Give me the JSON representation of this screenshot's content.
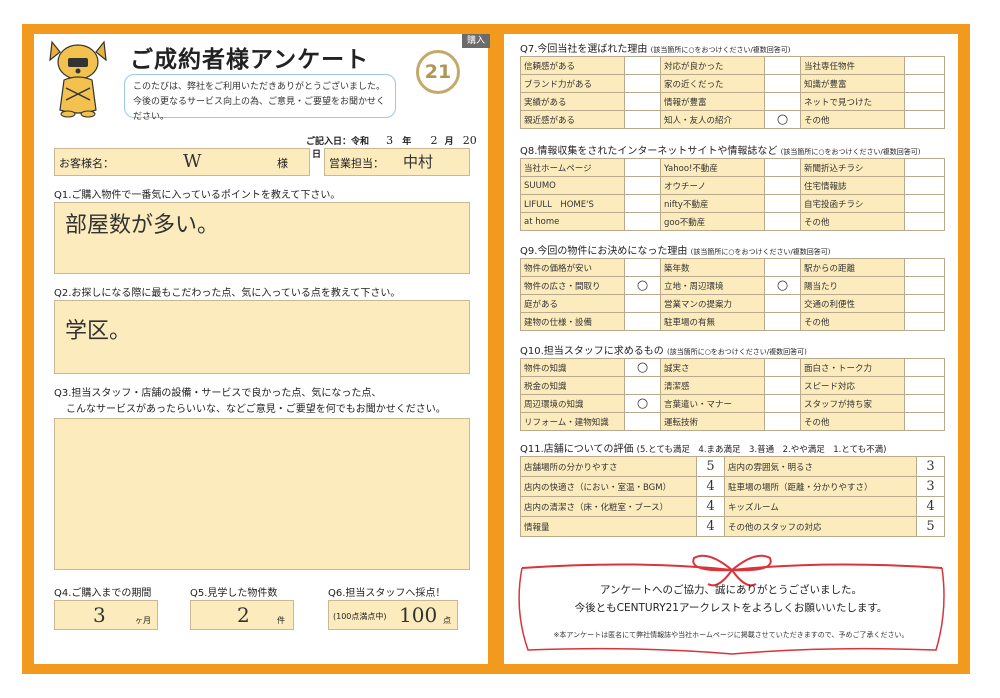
{
  "header": {
    "tag": "購入",
    "title": "ご成約者様アンケート",
    "intro_line1": "このたびは、弊社をご利用いただきありがとうございました。",
    "intro_line2": "今後の更なるサービス向上の為、ご意見・ご要望をお聞かせください。",
    "logo_text": "21",
    "date": {
      "label": "ご記入日：令和",
      "year": "3",
      "year_unit": "年",
      "month": "2",
      "month_unit": "月",
      "day": "20",
      "day_unit": "日"
    }
  },
  "customer": {
    "label": "お客様名：",
    "value": "W",
    "suffix": "様"
  },
  "staff": {
    "label": "営業担当：",
    "value": "中村"
  },
  "q1": {
    "question": "Q1.ご購入物件で一番気に入っているポイントを教えて下さい。",
    "answer": "部屋数が多い。"
  },
  "q2": {
    "question": "Q2.お探しになる際に最もこだわった点、気に入っている点を教えて下さい。",
    "answer": "学区。"
  },
  "q3": {
    "question_line1": "Q3.担当スタッフ・店舗の設備・サービスで良かった点、気になった点、",
    "question_line2": "こんなサービスがあったらいいな、などご意見・ご要望を何でもお聞かせください。",
    "answer": ""
  },
  "q4": {
    "question": "Q4.ご購入までの期間",
    "value": "3",
    "unit": "ヶ月"
  },
  "q5": {
    "question": "Q5.見学した物件数",
    "value": "2",
    "unit": "件"
  },
  "q6": {
    "question": "Q6.担当スタッフへ採点！",
    "prefix": "(100点満点中)",
    "value": "100",
    "unit": "点"
  },
  "q7": {
    "question": "Q7.今回当社を選ばれた理由",
    "note": "(該当箇所に○をおつけください/複数回答可)",
    "rows": [
      [
        {
          "label": "信頼感がある",
          "mark": ""
        },
        {
          "label": "対応が良かった",
          "mark": ""
        },
        {
          "label": "当社専任物件",
          "mark": ""
        }
      ],
      [
        {
          "label": "ブランド力がある",
          "mark": ""
        },
        {
          "label": "家の近くだった",
          "mark": ""
        },
        {
          "label": "知識が豊富",
          "mark": ""
        }
      ],
      [
        {
          "label": "実績がある",
          "mark": ""
        },
        {
          "label": "情報が豊富",
          "mark": ""
        },
        {
          "label": "ネットで見つけた",
          "mark": ""
        }
      ],
      [
        {
          "label": "親近感がある",
          "mark": ""
        },
        {
          "label": "知人・友人の紹介",
          "mark": "○"
        },
        {
          "label": "その他",
          "mark": ""
        }
      ]
    ]
  },
  "q8": {
    "question": "Q8.情報収集をされたインターネットサイトや情報誌など",
    "note": "(該当箇所に○をおつけください/複数回答可)",
    "rows": [
      [
        {
          "label": "当社ホームページ",
          "mark": ""
        },
        {
          "label": "Yahoo!不動産",
          "mark": ""
        },
        {
          "label": "新聞折込チラシ",
          "mark": ""
        }
      ],
      [
        {
          "label": "SUUMO",
          "mark": ""
        },
        {
          "label": "オウチーノ",
          "mark": ""
        },
        {
          "label": "住宅情報誌",
          "mark": ""
        }
      ],
      [
        {
          "label": "LIFULL　HOME'S",
          "mark": ""
        },
        {
          "label": "nifty不動産",
          "mark": ""
        },
        {
          "label": "自宅投函チラシ",
          "mark": ""
        }
      ],
      [
        {
          "label": "at home",
          "mark": ""
        },
        {
          "label": "goo不動産",
          "mark": ""
        },
        {
          "label": "その他",
          "mark": ""
        }
      ]
    ]
  },
  "q9": {
    "question": "Q9.今回の物件にお決めになった理由",
    "note": "(該当箇所に○をおつけください/複数回答可)",
    "rows": [
      [
        {
          "label": "物件の価格が安い",
          "mark": ""
        },
        {
          "label": "築年数",
          "mark": ""
        },
        {
          "label": "駅からの距離",
          "mark": ""
        }
      ],
      [
        {
          "label": "物件の広さ・間取り",
          "mark": "○"
        },
        {
          "label": "立地・周辺環境",
          "mark": "○"
        },
        {
          "label": "陽当たり",
          "mark": ""
        }
      ],
      [
        {
          "label": "庭がある",
          "mark": ""
        },
        {
          "label": "営業マンの提案力",
          "mark": ""
        },
        {
          "label": "交通の利便性",
          "mark": ""
        }
      ],
      [
        {
          "label": "建物の仕様・設備",
          "mark": ""
        },
        {
          "label": "駐車場の有無",
          "mark": ""
        },
        {
          "label": "その他",
          "mark": ""
        }
      ]
    ]
  },
  "q10": {
    "question": "Q10.担当スタッフに求めるもの",
    "note": "(該当箇所に○をおつけください/複数回答可)",
    "rows": [
      [
        {
          "label": "物件の知識",
          "mark": "○"
        },
        {
          "label": "誠実さ",
          "mark": ""
        },
        {
          "label": "面白さ・トーク力",
          "mark": ""
        }
      ],
      [
        {
          "label": "税金の知識",
          "mark": ""
        },
        {
          "label": "清潔感",
          "mark": ""
        },
        {
          "label": "スピード対応",
          "mark": ""
        }
      ],
      [
        {
          "label": "周辺環境の知識",
          "mark": "○"
        },
        {
          "label": "言葉遣い・マナー",
          "mark": ""
        },
        {
          "label": "スタッフが持ち家",
          "mark": ""
        }
      ],
      [
        {
          "label": "リフォーム・建物知識",
          "mark": ""
        },
        {
          "label": "運転技術",
          "mark": ""
        },
        {
          "label": "その他",
          "mark": ""
        }
      ]
    ]
  },
  "q11": {
    "question": "Q11.店舗についての評価",
    "scale": "(5.とても満足　4.まあ満足　3.普通　2.やや満足　1.とても不満)",
    "rows": [
      [
        {
          "label": "店舗場所の分かりやすさ",
          "score": "5"
        },
        {
          "label": "店内の雰囲気・明るさ",
          "score": "3"
        }
      ],
      [
        {
          "label": "店内の快適さ（におい・室温・BGM）",
          "score": "4"
        },
        {
          "label": "駐車場の場所（距離・分かりやすさ）",
          "score": "3"
        }
      ],
      [
        {
          "label": "店内の清潔さ（床・化粧室・ブース）",
          "score": "4"
        },
        {
          "label": "キッズルーム",
          "score": "4"
        }
      ],
      [
        {
          "label": "情報量",
          "score": "4"
        },
        {
          "label": "その他のスタッフの対応",
          "score": "5"
        }
      ]
    ]
  },
  "footer": {
    "thanks_line1": "アンケートへのご協力、誠にありがとうございました。",
    "thanks_line2": "今後ともCENTURY21アークレストをよろしくお願いいたします。",
    "note": "※本アンケートは匿名にて弊社情報誌や当社ホームページに掲載させていただきますので、予めご了承ください。"
  },
  "colors": {
    "frame": "#f29a1e",
    "field": "#fcebbd",
    "ribbon": "#d9343a",
    "logo": "#b19652"
  }
}
